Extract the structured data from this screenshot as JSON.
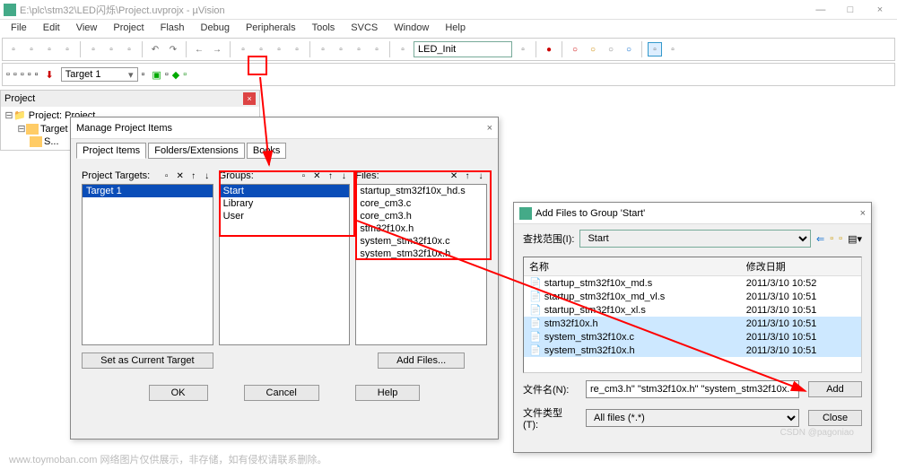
{
  "title": "E:\\plc\\stm32\\LED闪烁\\Project.uvprojx - µVision",
  "menu": [
    "File",
    "Edit",
    "View",
    "Project",
    "Flash",
    "Debug",
    "Peripherals",
    "Tools",
    "SVCS",
    "Window",
    "Help"
  ],
  "toolbar": {
    "search_value": "LED_Init"
  },
  "toolbar2": {
    "target": "Target 1"
  },
  "project_panel": {
    "title": "Project",
    "root": "Project: Project",
    "target": "Target 1",
    "group": "S..."
  },
  "dlg1": {
    "title": "Manage Project Items",
    "tabs": [
      "Project Items",
      "Folders/Extensions",
      "Books"
    ],
    "col_targets": "Project Targets:",
    "col_groups": "Groups:",
    "col_files": "Files:",
    "targets": [
      "Target 1"
    ],
    "groups": [
      "Start",
      "Library",
      "User"
    ],
    "files": [
      "startup_stm32f10x_hd.s",
      "core_cm3.c",
      "core_cm3.h",
      "stm32f10x.h",
      "system_stm32f10x.c",
      "system_stm32f10x.h"
    ],
    "set_current": "Set as Current Target",
    "add_files": "Add Files...",
    "ok": "OK",
    "cancel": "Cancel",
    "help": "Help"
  },
  "dlg2": {
    "title": "Add Files to Group 'Start'",
    "look_in_label": "查找范围(I):",
    "look_in_value": "Start",
    "col_name": "名称",
    "col_date": "修改日期",
    "rows": [
      {
        "n": "startup_stm32f10x_md.s",
        "d": "2011/3/10 10:52"
      },
      {
        "n": "startup_stm32f10x_md_vl.s",
        "d": "2011/3/10 10:51"
      },
      {
        "n": "startup_stm32f10x_xl.s",
        "d": "2011/3/10 10:51"
      },
      {
        "n": "stm32f10x.h",
        "d": "2011/3/10 10:51"
      },
      {
        "n": "system_stm32f10x.c",
        "d": "2011/3/10 10:51"
      },
      {
        "n": "system_stm32f10x.h",
        "d": "2011/3/10 10:51"
      }
    ],
    "sel": [
      3,
      4,
      5
    ],
    "fname_label": "文件名(N):",
    "fname_value": "re_cm3.h\" \"stm32f10x.h\" \"system_stm32f10x.",
    "ftype_label": "文件类型(T):",
    "ftype_value": "All files (*.*)",
    "add": "Add",
    "close": "Close"
  },
  "watermark": "www.toymoban.com  网络图片仅供展示，非存储，如有侵权请联系删除。",
  "watermark2": "CSDN @pagoniao"
}
